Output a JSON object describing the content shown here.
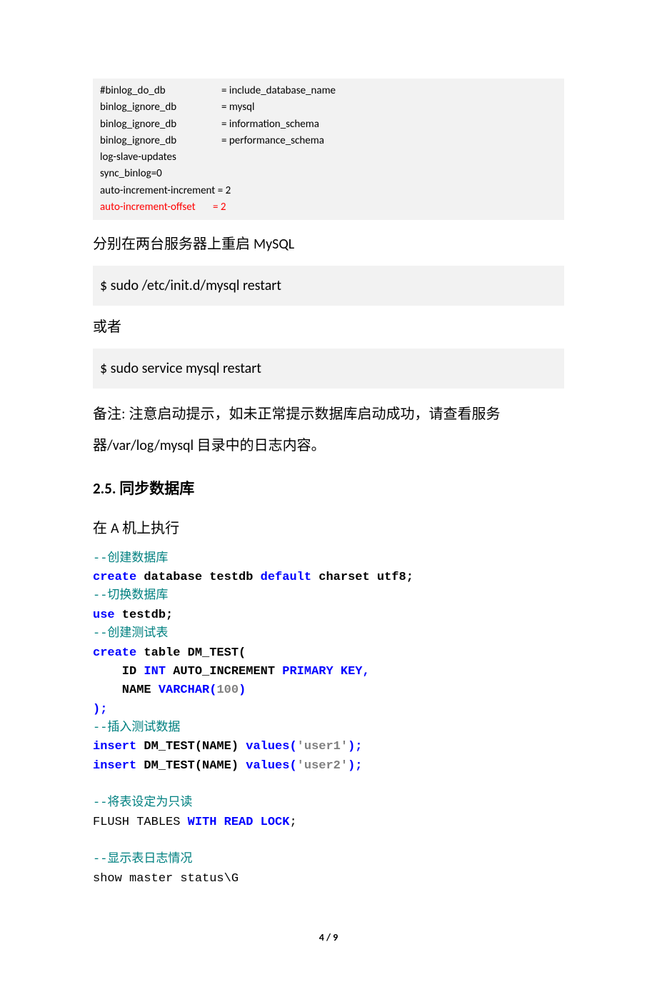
{
  "config": {
    "lines": [
      {
        "key": "#binlog_do_db",
        "sep": "= ",
        "val": "include_database_name",
        "red": false
      },
      {
        "key": "binlog_ignore_db",
        "sep": "= ",
        "val": "mysql",
        "red": false
      },
      {
        "key": "binlog_ignore_db",
        "sep": "= ",
        "val": "information_schema",
        "red": false
      },
      {
        "key": "binlog_ignore_db",
        "sep": "= ",
        "val": "performance_schema",
        "red": false
      },
      {
        "key": "log-slave-updates",
        "sep": "",
        "val": "",
        "red": false
      },
      {
        "key": "sync_binlog=0",
        "sep": "",
        "val": "",
        "red": false
      },
      {
        "key": "auto-increment-increment = 2",
        "sep": "",
        "val": "",
        "red": false
      },
      {
        "key": "auto-increment-offset",
        "sep": "= ",
        "val": "2",
        "red": true
      }
    ]
  },
  "para1_pre": "分别在两台服务器上重启 ",
  "para1_latin": "MySQL",
  "cmd1": "$ sudo /etc/init.d/mysql restart",
  "para2": "或者",
  "cmd2": "$ sudo service mysql restart",
  "note_pre": "备注: 注意启动提示，如未正常提示数据库启动成功，请查看服务器",
  "note_latin": "/var/log/mysql ",
  "note_post": "目录中的日志内容。",
  "heading": "2.5.  同步数据库",
  "para3_pre": "在 ",
  "para3_latin": "A ",
  "para3_post": "机上执行",
  "code": {
    "c1": "--创建数据库",
    "c2a": "create",
    "c2b": " database testdb ",
    "c2c": "default",
    "c2d": " charset utf8;",
    "c3": "--切换数据库",
    "c4a": "use",
    "c4b": " testdb;",
    "c5": "--创建测试表",
    "c6a": "create",
    "c6b": " table DM_TEST(",
    "c7a": "    ID ",
    "c7b": "INT",
    "c7c": " AUTO_INCREMENT ",
    "c7d": "PRIMARY KEY,",
    "c8a": "    NAME ",
    "c8b": "VARCHAR(",
    "c8c": "100",
    "c8d": ")",
    "c9": ");",
    "c10": "--插入测试数据",
    "c11a": "insert",
    "c11b": " DM_TEST(NAME) ",
    "c11c": "values(",
    "c11d": "'user1'",
    "c11e": ");",
    "c12a": "insert",
    "c12b": " DM_TEST(NAME) ",
    "c12c": "values(",
    "c12d": "'user2'",
    "c12e": ");",
    "c13": "--将表设定为只读",
    "c14a": "FLUSH TABLES ",
    "c14b": "WITH READ LOCK",
    "c14c": ";",
    "c15": "--显示表日志情况",
    "c16": "show master status\\G"
  },
  "footer": "4 / 9"
}
